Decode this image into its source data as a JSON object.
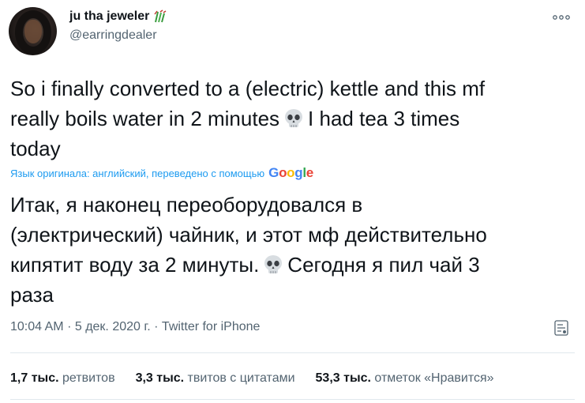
{
  "author": {
    "display_name": "ju tha jeweler",
    "name_emoji": "sparkle-bamboo-emoji",
    "handle": "@earringdealer"
  },
  "tweet": {
    "lines": [
      "So i finally converted to a (electric)  kettle and this mf",
      "really boils water in 2 minutes",
      "I had tea 3 times",
      "today"
    ],
    "emoji": "skull-emoji"
  },
  "translation": {
    "notice": "Язык оригинала: английский, переведено с помощью",
    "provider": "Google",
    "lines": [
      "Итак, я наконец переоборудовался в",
      "(электрический) чайник, и этот мф действительно",
      "кипятит воду за 2 минуты.",
      "Сегодня я пил чай 3",
      "раза"
    ]
  },
  "meta": {
    "time": "10:04 AM",
    "date": "5 дек. 2020 г.",
    "separator": "·",
    "source": "Twitter for iPhone"
  },
  "stats": {
    "retweets": {
      "count": "1,7 тыс.",
      "label": "ретвитов"
    },
    "quotes": {
      "count": "3,3 тыс.",
      "label": "твитов с цитатами"
    },
    "likes": {
      "count": "53,3 тыс.",
      "label": "отметок «Нравится»"
    }
  },
  "colors": {
    "link": "#1d9bf0",
    "muted": "#536471",
    "text": "#0f1419",
    "divider": "#e1e8ed"
  },
  "icons": {
    "more": "more-horizontal-icon",
    "analytics": "analytics-icon"
  }
}
